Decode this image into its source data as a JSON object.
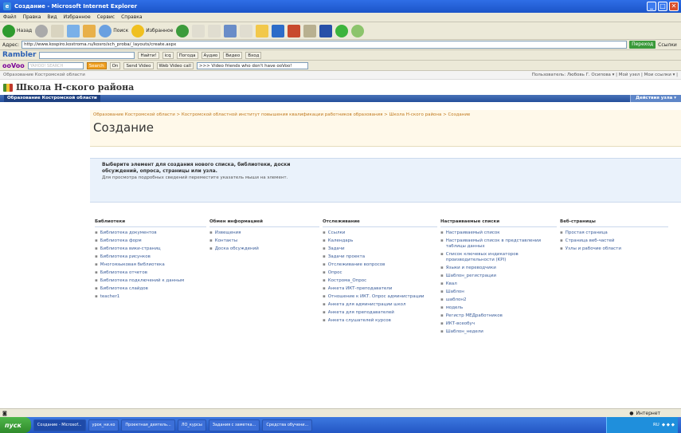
{
  "window": {
    "title": "Создание - Microsoft Internet Explorer"
  },
  "menu": [
    "Файл",
    "Правка",
    "Вид",
    "Избранное",
    "Сервис",
    "Справка"
  ],
  "toolbar": {
    "back": "Назад",
    "search": "Поиск",
    "favorites": "Избранное"
  },
  "address": {
    "label": "Адрес:",
    "url": "http://www.kospiro.kostroma.ru/kosro/sch_proba/_layouts/create.aspx",
    "go": "Переход",
    "links": "Ссылки"
  },
  "rambler": {
    "logo": "Rambler",
    "btn_label": "Найти!",
    "icq": "icq",
    "weather": "Погода",
    "audio": "Аудио",
    "video": "Видео",
    "login": "Вход"
  },
  "yahoo": {
    "logo": "YAHOO!",
    "search_placeholder": "YAHOO! SEARCH",
    "search_btn": "Search",
    "on": "On",
    "send_video": "Send Video",
    "web_video_call": "Web Video call",
    "video_text": ">>> Video friends who don't have ooVoo!"
  },
  "sp": {
    "top_left": "Образование Костромской области",
    "user": "Пользователь: Любовь Г. Осипова ▾ | Мой узел | Мои ссылки ▾ |",
    "site_title": "Школа Н-ского района",
    "nav_tab": "Образование Костромской области",
    "site_actions": "Действия узла ▾",
    "breadcrumb": "Образование Костромской области > Костромской областной институт повышения квалификации работников образования > Школа Н-ского района > Создание",
    "page_title": "Создание",
    "desc_title": "Выберите элемент для создания нового списка, библиотеки, доски обсуждений, опроса, страницы или узла.",
    "desc_sub": "Для просмотра подробных сведений переместите указатель мыши на элемент."
  },
  "columns": [
    {
      "head": "Библиотеки",
      "items": [
        "Библиотека документов",
        "Библиотека форм",
        "Библиотека вики-страниц",
        "Библиотека рисунков",
        "Многоязыковая библиотека",
        "Библиотека отчетов",
        "Библиотека подключений к данным",
        "Библиотека слайдов",
        "teacher1"
      ]
    },
    {
      "head": "Обмен информацией",
      "items": [
        "Извещения",
        "Контакты",
        "Доска обсуждений"
      ]
    },
    {
      "head": "Отслеживание",
      "items": [
        "Ссылки",
        "Календарь",
        "Задачи",
        "Задачи проекта",
        "Отслеживание вопросов",
        "Опрос",
        "Кострома_Опрос",
        "Анкета ИКТ-преподаватели",
        "Отношение к ИКТ. Опрос администрации",
        "Анкета для администрации школ",
        "Анкета для преподавателей",
        "Анкета слушателей курсов"
      ]
    },
    {
      "head": "Настраиваемые списки",
      "items": [
        "Настраиваемый список",
        "Настраиваемый список в представлении таблицы данных",
        "Список ключевых индикаторов производительности (KPI)",
        "Языки и переводчики",
        "Шаблон_регистрации",
        "Квал",
        "Шаблон",
        "шаблон2",
        "модель",
        "Регистр МЕДработников",
        "ИКТ-всеобуч",
        "Шаблон_недели"
      ]
    },
    {
      "head": "Веб-страницы",
      "items": [
        "Простая страница",
        "Страница веб-частей",
        "Узлы и рабочие области"
      ]
    }
  ],
  "status": {
    "zone": "Интернет"
  },
  "taskbar": {
    "start": "пуск",
    "tasks": [
      "Создание - Microsof...",
      "урок_ни.ко",
      "Проектная_деятель...",
      "ЛО_курсы",
      "Задания с заметка...",
      "Средства обучени..."
    ],
    "clock": "RU"
  }
}
